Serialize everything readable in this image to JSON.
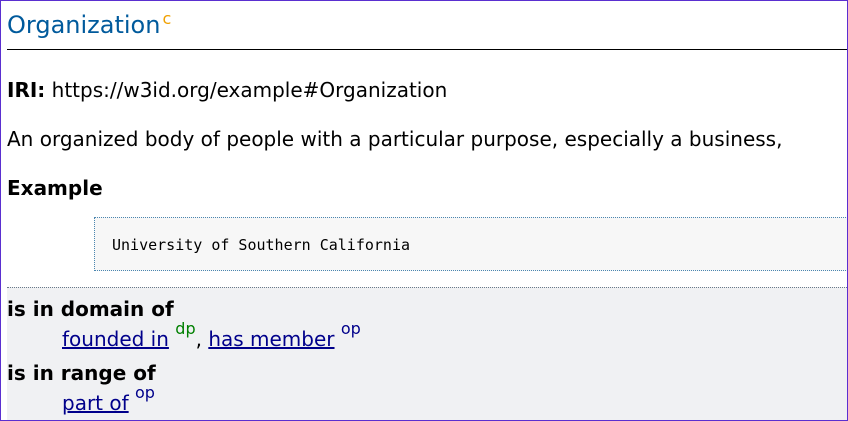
{
  "entity": {
    "title": "Organization",
    "type_marker": "c",
    "iri_label": "IRI:",
    "iri": "https://w3id.org/example#Organization",
    "description": "An organized body of people with a particular purpose, especially a business,",
    "example_heading": "Example",
    "example_text": "University of Southern California"
  },
  "domain_section": {
    "heading": "is in domain of",
    "links": [
      {
        "label": "founded in",
        "tag": "dp"
      },
      {
        "label": "has member",
        "tag": "op"
      }
    ],
    "separator": ","
  },
  "range_section": {
    "heading": "is in range of",
    "links": [
      {
        "label": "part of",
        "tag": "op"
      }
    ]
  },
  "colors": {
    "title": "#005a9c",
    "type_marker": "#f0a000",
    "link": "#00008b",
    "dp_tag": "#008000",
    "op_tag": "#00008b",
    "frame_border": "#5a2fd0"
  }
}
